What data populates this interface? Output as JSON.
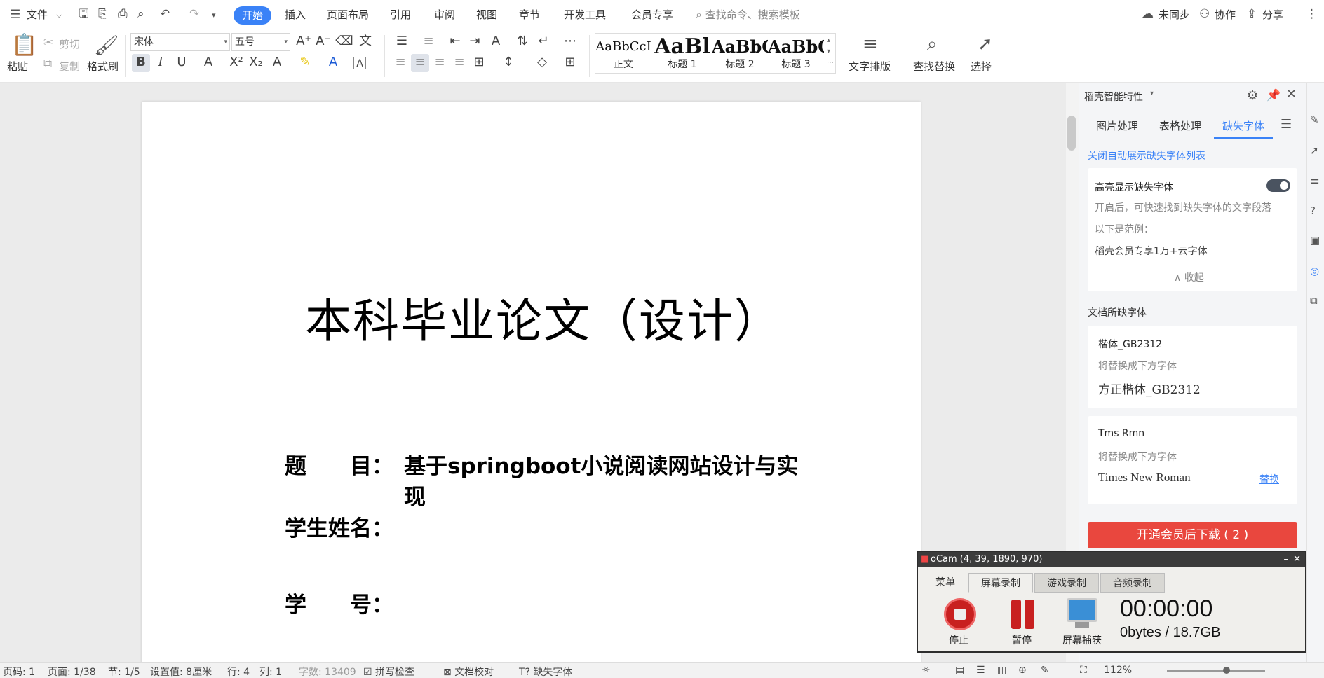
{
  "menubar": {
    "file_label": "文件",
    "tabs": [
      "开始",
      "插入",
      "页面布局",
      "引用",
      "审阅",
      "视图",
      "章节",
      "开发工具",
      "会员专享"
    ],
    "search_placeholder": "查找命令、搜索模板",
    "sync_label": "未同步",
    "collab_label": "协作",
    "share_label": "分享"
  },
  "ribbon": {
    "paste_label": "粘贴",
    "cut_label": "剪切",
    "copy_label": "复制",
    "format_painter_label": "格式刷",
    "font_name": "宋体",
    "font_size": "五号",
    "styles": [
      {
        "sample": "AaBbCcI",
        "name": "正文"
      },
      {
        "sample": "AaBl",
        "name": "标题 1"
      },
      {
        "sample": "AaBbC",
        "name": "标题 2"
      },
      {
        "sample": "AaBbC",
        "name": "标题 3"
      }
    ],
    "text_layout_label": "文字排版",
    "find_replace_label": "查找替换",
    "select_label": "选择"
  },
  "document": {
    "title": "本科毕业论文（设计）",
    "field_topic_label": "题　　目：",
    "field_topic_value_1": "基于springboot小说阅读网站设计与实",
    "field_topic_value_2": "现",
    "field_name_label": "学生姓名：",
    "field_id_label": "学　　号："
  },
  "panel": {
    "title": "稻壳智能特性",
    "tabs": [
      "图片处理",
      "表格处理",
      "缺失字体"
    ],
    "active_tab": "缺失字体",
    "close_auto_link": "关闭自动展示缺失字体列表",
    "highlight_label": "高亮显示缺失字体",
    "highlight_desc": "开启后，可快速找到缺失字体的文字段落",
    "example_label": "以下是范例：",
    "example_text": "稻壳会员专享1万+云字体",
    "collapse_label": "收起",
    "missing_section_title": "文档所缺字体",
    "missing_fonts": [
      {
        "name": "楷体_GB2312",
        "replace_hint": "将替换成下方字体",
        "replacement": "方正楷体_GB2312"
      },
      {
        "name": "Tms Rmn",
        "replace_hint": "将替换成下方字体",
        "replacement": "Times New Roman",
        "action": "替换"
      }
    ],
    "download_button": "开通会员后下载 ( 2 )"
  },
  "ocam": {
    "title": "oCam (4, 39, 1890, 970)",
    "tabs": [
      "菜单",
      "屏幕录制",
      "游戏录制",
      "音频录制"
    ],
    "active_tab": "屏幕录制",
    "stop_label": "停止",
    "pause_label": "暂停",
    "capture_label": "屏幕捕获",
    "time": "00:00:00",
    "size": "0bytes / 18.7GB"
  },
  "status": {
    "page_num": "页码: 1",
    "page_of": "页面: 1/38",
    "section": "节: 1/5",
    "setting": "设置值: 8厘米",
    "row": "行: 4",
    "col": "列: 1",
    "word_count": "字数: 13409",
    "spell_check": "拼写检查",
    "doc_proof": "文档校对",
    "missing_font": "缺失字体",
    "zoom": "112%"
  },
  "colors": {
    "accent": "#3a82f7",
    "download_red": "#e9473e",
    "link_blue": "#3a82f7"
  }
}
